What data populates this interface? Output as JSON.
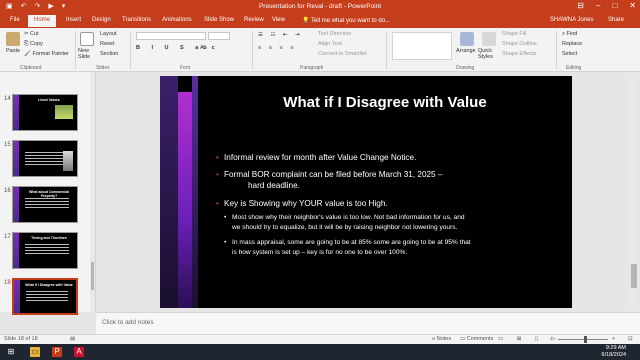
{
  "titlebar": {
    "title": "Presentation for Reval - draft - PowerPoint",
    "qat": [
      "save-icon",
      "undo-icon",
      "redo-icon",
      "start-icon",
      "customize-icon"
    ],
    "controls": [
      "⊟",
      "–",
      "□",
      "✕"
    ]
  },
  "tabs": [
    "File",
    "Home",
    "Insert",
    "Design",
    "Transitions",
    "Animations",
    "Slide Show",
    "Review",
    "View"
  ],
  "active_tab": "Home",
  "tellme": "Tell me what you want to do...",
  "user": "SHAWNA Jones",
  "share": "Share",
  "ribbon": {
    "clipboard": {
      "paste": "Paste",
      "cut": "Cut",
      "copy": "Copy",
      "format_painter": "Format Painter",
      "label": "Clipboard"
    },
    "slides": {
      "new_slide": "New Slide",
      "layout": "Layout",
      "reset": "Reset",
      "section": "Section",
      "label": "Slides"
    },
    "font": {
      "label": "Font"
    },
    "paragraph": {
      "text_direction": "Text Direction",
      "align_text": "Align Text",
      "smartart": "Convert to SmartArt",
      "label": "Paragraph"
    },
    "drawing": {
      "arrange": "Arrange",
      "quick_styles": "Quick Styles",
      "shape_fill": "Shape Fill",
      "shape_outline": "Shape Outline",
      "shape_effects": "Shape Effects",
      "label": "Drawing"
    },
    "editing": {
      "find": "Find",
      "replace": "Replace",
      "select": "Select",
      "label": "Editing"
    }
  },
  "thumbnails": [
    {
      "num": "14",
      "title": "Lined Values"
    },
    {
      "num": "15",
      "title": ""
    },
    {
      "num": "16",
      "title": "What about Commercial Property?"
    },
    {
      "num": "17",
      "title": "Timing and Timelines"
    },
    {
      "num": "18",
      "title": "What if I Disagree with Value"
    }
  ],
  "slide": {
    "title": "What if I Disagree with Value",
    "bullets": [
      "Informal review for month after Value Change Notice.",
      "Formal BOR complaint can be filed before March 31, 2025 –",
      "hard deadline.",
      "Key is Showing why YOUR value is too High."
    ],
    "subbullets": [
      "Most show why their neighbor's value is too low.  Not bad information for us, and",
      "we should try to equalize, but it will be by raising neighbor not lowering yours.",
      "In mass appraisal, some are going to be at 85% some are going to be at 95% that",
      "is how system is set up – key is for no one to be over 100%."
    ]
  },
  "notes_placeholder": "Click to add notes",
  "status": {
    "slide_of": "Slide 18 of 18",
    "notes": "Notes",
    "comments": "Comments"
  },
  "taskbar": {
    "time": "9:29 AM",
    "date": "6/18/2024"
  }
}
